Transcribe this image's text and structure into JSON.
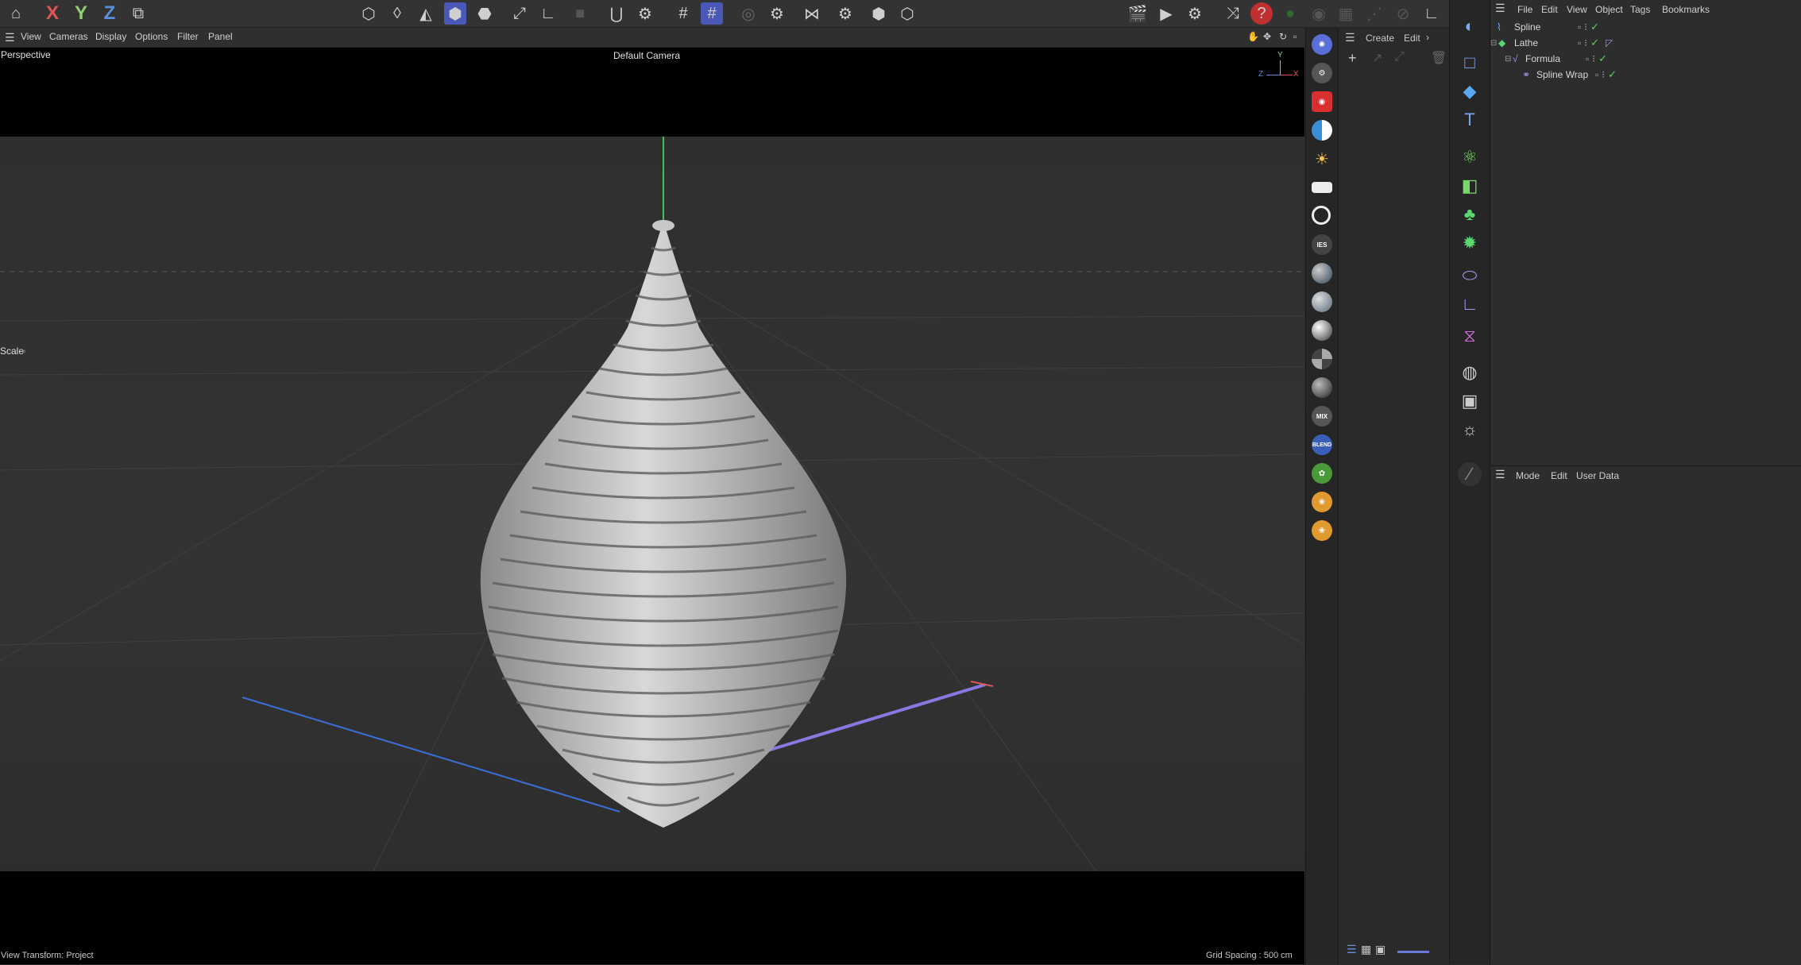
{
  "topbar": {
    "axis_labels": [
      "X",
      "Y",
      "Z"
    ],
    "icons": [
      "undo-icon",
      "coordinate-system-icon",
      "model-mode-icon",
      "polygon-mode-icon",
      "edge-mode-icon",
      "point-mode-icon",
      "object-mode-icon",
      "texture-mode-icon",
      "move-tool-icon",
      "scale-tool-icon",
      "live-selection-icon",
      "snap-icon",
      "snap-settings-icon",
      "grid-icon",
      "workplane-icon",
      "quantize-icon",
      "settings-icon",
      "symmetry-icon",
      "symmetry-settings-icon",
      "interactive-render-icon",
      "render-region-icon",
      "render-view-icon",
      "render-picture-viewer-icon",
      "render-settings-icon",
      "shuffle-icon",
      "help-icon",
      "dot-icon",
      "eye-icon",
      "layout-icon",
      "disabled-icon",
      "pin-icon"
    ]
  },
  "viewport_menu": {
    "items": [
      "View",
      "Cameras",
      "Display",
      "Options",
      "Filter",
      "Panel"
    ]
  },
  "viewport": {
    "view_name": "Perspective",
    "camera_label": "Default Camera",
    "tool_label": "Scale",
    "status_left": "View Transform: Project",
    "status_right": "Grid Spacing : 500 cm",
    "gizmo": {
      "x": "X",
      "y": "Y",
      "z": "Z"
    }
  },
  "create_panel": {
    "menu": [
      "Create",
      "Edit"
    ]
  },
  "right_strip": {
    "icons": [
      "redshift-logo-icon",
      "gear-icon",
      "camera-icon",
      "dome-light-icon",
      "sun-icon",
      "area-light-icon",
      "target-icon",
      "ies-icon",
      "sphere-material-icon",
      "glass-material-icon",
      "chrome-material-icon",
      "checker-material-icon",
      "toon-material-icon",
      "mix-icon",
      "blend-icon",
      "tree-icon",
      "puffs-icon",
      "puffs-alt-icon"
    ],
    "text_icons": {
      "ies": "IES",
      "mix": "MIX",
      "blend": "BLEND"
    }
  },
  "tool_column": {
    "icons": [
      "sphere-primitive-icon",
      "rectangle-spline-icon",
      "cube-icon",
      "text-icon",
      "cloner-icon",
      "extrude-icon",
      "mograph-icon",
      "effector-icon",
      "deformer-icon",
      "field-icon",
      "spline-wrap-icon",
      "scene-icon",
      "camera-tool-icon",
      "light-tool-icon",
      "brush-icon"
    ]
  },
  "object_manager": {
    "menu": [
      "File",
      "Edit",
      "View",
      "Object",
      "Tags",
      "Bookmarks"
    ],
    "objects": [
      {
        "name": "Spline",
        "indent": 0
      },
      {
        "name": "Lathe",
        "indent": 0
      },
      {
        "name": "Formula",
        "indent": 1
      },
      {
        "name": "Spline Wrap",
        "indent": 2
      }
    ]
  },
  "attribute_manager": {
    "menu": [
      "Mode",
      "Edit",
      "User Data"
    ]
  },
  "colors": {
    "accent": "#4a58b8",
    "axis_x": "#e05555",
    "axis_y": "#8fd070",
    "axis_z": "#5a8fe0",
    "check": "#5fd35f"
  }
}
